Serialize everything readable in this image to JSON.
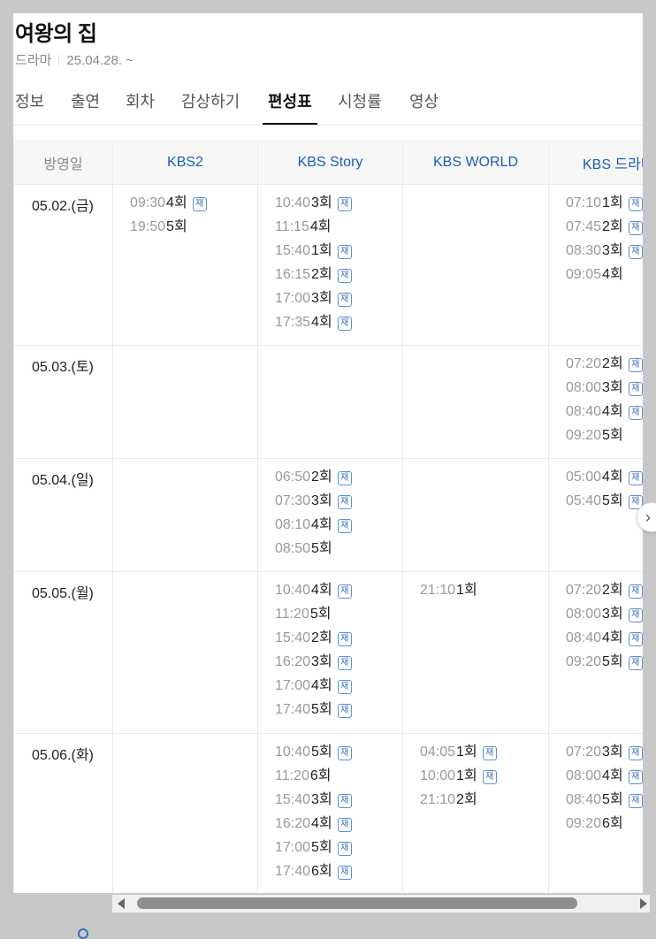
{
  "program": {
    "title": "여왕의 집",
    "genre": "드라마",
    "date_range": "25.04.28. ~"
  },
  "tabs": [
    {
      "label": "정보"
    },
    {
      "label": "출연"
    },
    {
      "label": "회차"
    },
    {
      "label": "감상하기"
    },
    {
      "label": "편성표",
      "active": true
    },
    {
      "label": "시청률"
    },
    {
      "label": "영상"
    }
  ],
  "schedule": {
    "date_header": "방영일",
    "channels": [
      "KBS2",
      "KBS Story",
      "KBS WORLD",
      "KBS 드라마"
    ],
    "rerun_label": "재",
    "rows": [
      {
        "date": "05.02.(금)",
        "cells": [
          [
            {
              "time": "09:30",
              "ep": "4회",
              "rerun": true
            },
            {
              "time": "19:50",
              "ep": "5회",
              "rerun": false
            }
          ],
          [
            {
              "time": "10:40",
              "ep": "3회",
              "rerun": true
            },
            {
              "time": "11:15",
              "ep": "4회",
              "rerun": false
            },
            {
              "time": "15:40",
              "ep": "1회",
              "rerun": true
            },
            {
              "time": "16:15",
              "ep": "2회",
              "rerun": true
            },
            {
              "time": "17:00",
              "ep": "3회",
              "rerun": true
            },
            {
              "time": "17:35",
              "ep": "4회",
              "rerun": true
            }
          ],
          [],
          [
            {
              "time": "07:10",
              "ep": "1회",
              "rerun": true
            },
            {
              "time": "07:45",
              "ep": "2회",
              "rerun": true
            },
            {
              "time": "08:30",
              "ep": "3회",
              "rerun": true
            },
            {
              "time": "09:05",
              "ep": "4회",
              "rerun": false
            }
          ]
        ]
      },
      {
        "date": "05.03.(토)",
        "cells": [
          [],
          [],
          [],
          [
            {
              "time": "07:20",
              "ep": "2회",
              "rerun": true
            },
            {
              "time": "08:00",
              "ep": "3회",
              "rerun": true
            },
            {
              "time": "08:40",
              "ep": "4회",
              "rerun": true
            },
            {
              "time": "09:20",
              "ep": "5회",
              "rerun": false
            }
          ]
        ]
      },
      {
        "date": "05.04.(일)",
        "cells": [
          [],
          [
            {
              "time": "06:50",
              "ep": "2회",
              "rerun": true
            },
            {
              "time": "07:30",
              "ep": "3회",
              "rerun": true
            },
            {
              "time": "08:10",
              "ep": "4회",
              "rerun": true
            },
            {
              "time": "08:50",
              "ep": "5회",
              "rerun": false
            }
          ],
          [],
          [
            {
              "time": "05:00",
              "ep": "4회",
              "rerun": true
            },
            {
              "time": "05:40",
              "ep": "5회",
              "rerun": true
            }
          ]
        ]
      },
      {
        "date": "05.05.(월)",
        "cells": [
          [],
          [
            {
              "time": "10:40",
              "ep": "4회",
              "rerun": true
            },
            {
              "time": "11:20",
              "ep": "5회",
              "rerun": false
            },
            {
              "time": "15:40",
              "ep": "2회",
              "rerun": true
            },
            {
              "time": "16:20",
              "ep": "3회",
              "rerun": true
            },
            {
              "time": "17:00",
              "ep": "4회",
              "rerun": true
            },
            {
              "time": "17:40",
              "ep": "5회",
              "rerun": true
            }
          ],
          [
            {
              "time": "21:10",
              "ep": "1회",
              "rerun": false
            }
          ],
          [
            {
              "time": "07:20",
              "ep": "2회",
              "rerun": true
            },
            {
              "time": "08:00",
              "ep": "3회",
              "rerun": true
            },
            {
              "time": "08:40",
              "ep": "4회",
              "rerun": true
            },
            {
              "time": "09:20",
              "ep": "5회",
              "rerun": true
            }
          ]
        ]
      },
      {
        "date": "05.06.(화)",
        "cells": [
          [],
          [
            {
              "time": "10:40",
              "ep": "5회",
              "rerun": true
            },
            {
              "time": "11:20",
              "ep": "6회",
              "rerun": false
            },
            {
              "time": "15:40",
              "ep": "3회",
              "rerun": true
            },
            {
              "time": "16:20",
              "ep": "4회",
              "rerun": true
            },
            {
              "time": "17:00",
              "ep": "5회",
              "rerun": true
            },
            {
              "time": "17:40",
              "ep": "6회",
              "rerun": true
            }
          ],
          [
            {
              "time": "04:05",
              "ep": "1회",
              "rerun": true
            },
            {
              "time": "10:00",
              "ep": "1회",
              "rerun": true
            },
            {
              "time": "21:10",
              "ep": "2회",
              "rerun": false
            }
          ],
          [
            {
              "time": "07:20",
              "ep": "3회",
              "rerun": true
            },
            {
              "time": "08:00",
              "ep": "4회",
              "rerun": true
            },
            {
              "time": "08:40",
              "ep": "5회",
              "rerun": true
            },
            {
              "time": "09:20",
              "ep": "6회",
              "rerun": false
            }
          ]
        ]
      }
    ]
  }
}
